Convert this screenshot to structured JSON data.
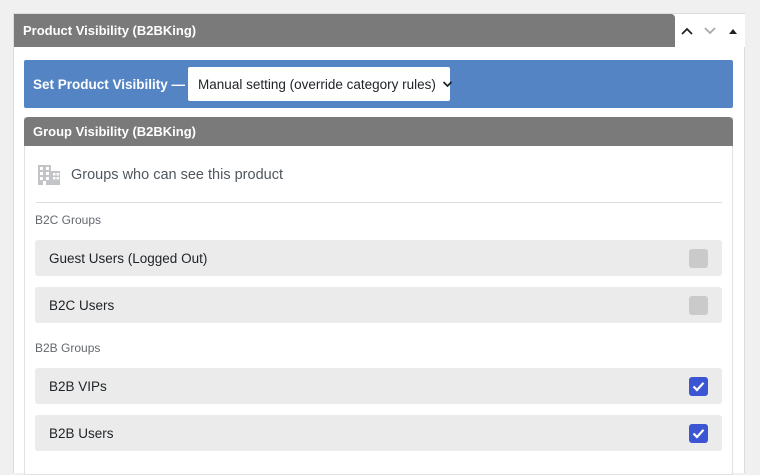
{
  "metabox": {
    "title": "Product Visibility (B2BKing)",
    "controls": [
      "move-up",
      "move-down",
      "toggle-panel"
    ]
  },
  "visibility": {
    "label": "Set Product Visibility —",
    "selected": "Manual setting (override category rules)"
  },
  "group_visibility": {
    "header": "Group Visibility (B2BKing)",
    "title": "Groups who can see this product",
    "title_icon": "building-icon",
    "sections": [
      {
        "label": "B2C Groups",
        "items": [
          {
            "label": "Guest Users (Logged Out)",
            "checked": false
          },
          {
            "label": "B2C Users",
            "checked": false
          }
        ]
      },
      {
        "label": "B2B Groups",
        "items": [
          {
            "label": "B2B VIPs",
            "checked": true
          },
          {
            "label": "B2B Users",
            "checked": true
          }
        ]
      }
    ]
  },
  "colors": {
    "header_gray": "#7a7a7a",
    "accent_blue": "#5484c4",
    "checkbox_checked": "#3b55d3",
    "checkbox_unchecked": "#cacaca",
    "row_bg": "#ebebeb"
  }
}
